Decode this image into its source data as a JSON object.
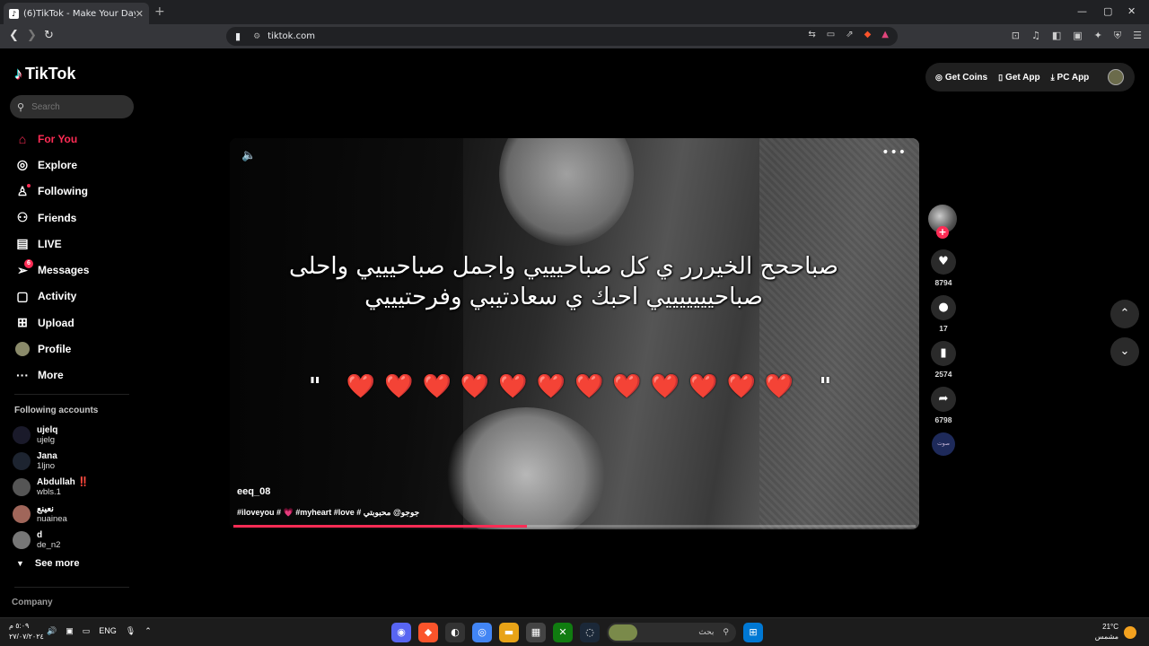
{
  "browser": {
    "tab_title": "(6)TikTok - Make Your Day",
    "tab_close": "✕",
    "new_tab": "+",
    "url": "tiktok.com",
    "window_controls": [
      "—",
      "▢",
      "✕"
    ]
  },
  "sidebar": {
    "logo_text": "TikTok",
    "search_placeholder": "Search",
    "menu": [
      {
        "label": "For You",
        "icon": "home-icon",
        "active": true
      },
      {
        "label": "Explore",
        "icon": "compass-icon"
      },
      {
        "label": "Following",
        "icon": "following-icon"
      },
      {
        "label": "Friends",
        "icon": "friends-icon"
      },
      {
        "label": "LIVE",
        "icon": "live-icon"
      },
      {
        "label": "Messages",
        "icon": "messages-icon",
        "badge": "6"
      },
      {
        "label": "Activity",
        "icon": "activity-icon"
      },
      {
        "label": "Upload",
        "icon": "upload-icon"
      },
      {
        "label": "Profile",
        "icon": "profile-avatar"
      },
      {
        "label": "More",
        "icon": "more-icon"
      }
    ],
    "following_title": "Following accounts",
    "accounts": [
      {
        "display": "ujelq",
        "user": "ujelg"
      },
      {
        "display": "Jana",
        "user": "1ljno"
      },
      {
        "display": "Abdullah ‼️",
        "user": "wbls.1"
      },
      {
        "display": "نعينع",
        "user": "nuainea"
      },
      {
        "display": "d",
        "user": "de_n2"
      }
    ],
    "see_more": "See more",
    "company": "Company"
  },
  "topbar": {
    "get_coins": "Get Coins",
    "get_app": "Get App",
    "pc_app": "PC App"
  },
  "video": {
    "overlay_text": "صباححح الخيررر ي كل صباحيييي واجمل صباحيييي واحلى صباحيييييييي احبك ي سعادتيبي وفرحتيييي",
    "hearts_open": "\"",
    "hearts": "❤️❤️❤️❤️❤️❤️❤️❤️❤️❤️❤️❤️",
    "hearts_close": "\"",
    "author": "eeq_08",
    "caption": "#iloveyou # 💗 #myheart #love # جوجو@ محبوبتي",
    "progress_percent": 43
  },
  "actions": {
    "likes": "8794",
    "comments": "17",
    "saves": "2574",
    "shares": "6798",
    "music_label": "صوت"
  },
  "taskbar": {
    "time": "٥:٠٩ م",
    "date": "٢٧/٠٧/٢٠٢٤",
    "lang": "ENG",
    "search_text": "بحث",
    "temp": "21°C",
    "weather": "مشمس"
  },
  "colors": {
    "accent": "#fe2c55",
    "background": "#000000"
  }
}
